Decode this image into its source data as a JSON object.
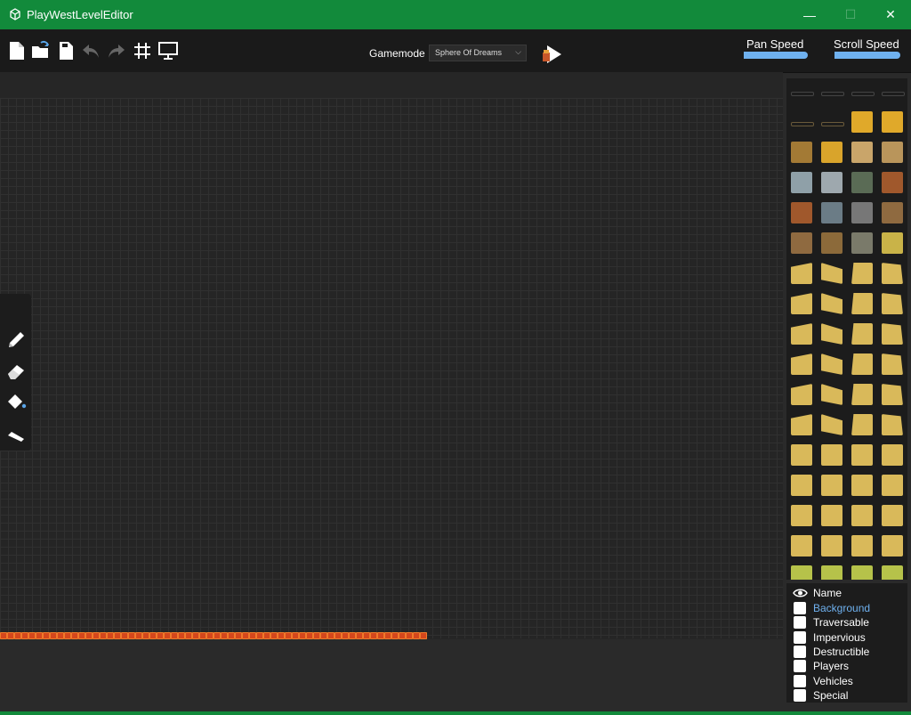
{
  "window": {
    "title": "PlayWestLevelEditor",
    "minimize": "—",
    "maximize": "☐",
    "close": "✕"
  },
  "toolbar": {
    "icons": [
      "new-file-icon",
      "open-file-icon",
      "save-file-icon",
      "undo-icon",
      "redo-icon",
      "grid-icon",
      "monitor-icon"
    ],
    "gamemode_label": "Gamemode",
    "gamemode_value": "Sphere Of Dreams",
    "pan_speed_label": "Pan Speed",
    "scroll_speed_label": "Scroll Speed",
    "pan_speed_value": 1.0,
    "scroll_speed_value": 1.0
  },
  "tools": [
    "pencil-icon",
    "eraser-icon",
    "fill-bucket-icon",
    "line-tool-icon"
  ],
  "layers": {
    "name_header": "Name",
    "items": [
      {
        "label": "Background",
        "active": true
      },
      {
        "label": "Traversable",
        "active": false
      },
      {
        "label": "Impervious",
        "active": false
      },
      {
        "label": "Destructible",
        "active": false
      },
      {
        "label": "Players",
        "active": false
      },
      {
        "label": "Vehicles",
        "active": false
      },
      {
        "label": "Special",
        "active": false
      }
    ]
  },
  "colors": {
    "titlebar": "#128a3b",
    "accent": "#6fb1ef",
    "active_layer": "#6fb1ef",
    "sand": "#d9b95a"
  }
}
